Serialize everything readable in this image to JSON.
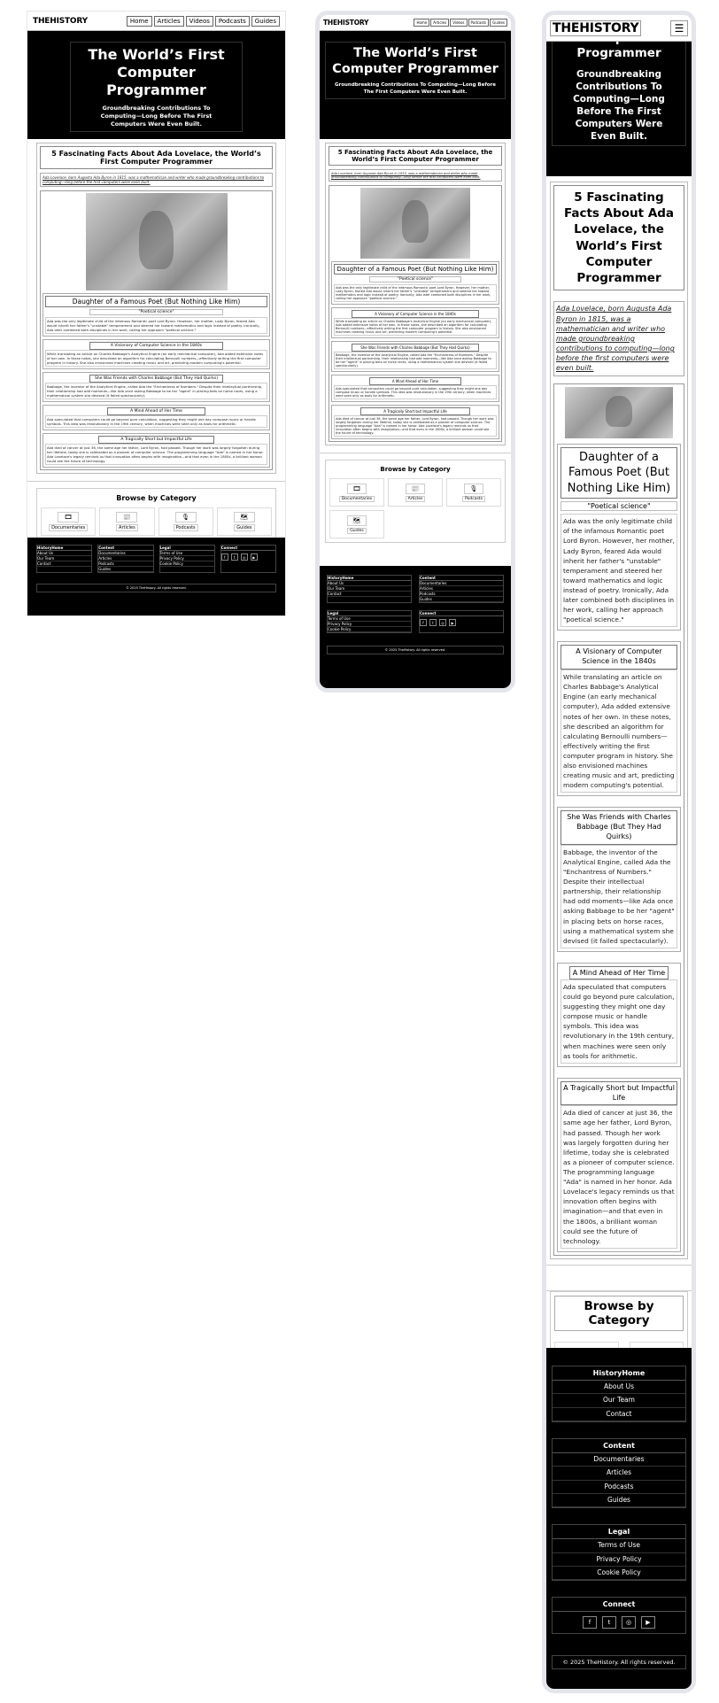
{
  "site": {
    "logo_prefix": "THE",
    "logo_suffix": "HISTORY",
    "nav": [
      "Home",
      "Articles",
      "Videos",
      "Podcasts",
      "Guides"
    ],
    "menu_icon": "hamburger-icon"
  },
  "hero": {
    "title": "The World’s First Computer Programmer",
    "subtitle": "Groundbreaking Contributions To Computing—Long Before The First Computers Were Even Built."
  },
  "article": {
    "title": "5 Fascinating Facts About Ada Lovelace, the World’s First Computer Programmer",
    "intro": "Ada Lovelace, born Augusta Ada Byron in 1815, was a mathematician and writer who made groundbreaking contributions to computing—long before the first computers were even built.",
    "image_alt": "Portrait of Ada Lovelace",
    "sections": [
      {
        "heading": "Daughter of a Famous Poet (But Nothing Like Him)",
        "subheading": "\"Poetical science\"",
        "text": "Ada was the only legitimate child of the infamous Romantic poet Lord Byron. However, her mother, Lady Byron, feared Ada would inherit her father's \"unstable\" temperament and steered her toward mathematics and logic instead of poetry. Ironically, Ada later combined both disciplines in her work, calling her approach \"poetical science.\""
      },
      {
        "heading": "A Visionary of Computer Science in the 1840s",
        "text": "While translating an article on Charles Babbage's Analytical Engine (an early mechanical computer), Ada added extensive notes of her own. In these notes, she described an algorithm for calculating Bernoulli numbers—effectively writing the first computer program in history. She also envisioned machines creating music and art, predicting modern computing's potential."
      },
      {
        "heading": "She Was Friends with Charles Babbage (But They Had Quirks)",
        "text": "Babbage, the inventor of the Analytical Engine, called Ada the \"Enchantress of Numbers.\" Despite their intellectual partnership, their relationship had odd moments—like Ada once asking Babbage to be her \"agent\" in placing bets on horse races, using a mathematical system she devised (it failed spectacularly)."
      },
      {
        "heading": "A Mind Ahead of Her Time",
        "text": "Ada speculated that computers could go beyond pure calculation, suggesting they might one day compose music or handle symbols. This idea was revolutionary in the 19th century, when machines were seen only as tools for arithmetic."
      },
      {
        "heading": "A Tragically Short but Impactful Life",
        "text": "Ada died of cancer at just 36, the same age her father, Lord Byron, had passed. Though her work was largely forgotten during her lifetime, today she is celebrated as a pioneer of computer science. The programming language \"Ada\" is named in her honor. Ada Lovelace's legacy reminds us that innovation often begins with imagination—and that even in the 1800s, a brilliant woman could see the future of technology."
      }
    ]
  },
  "browse": {
    "title": "Browse by Category",
    "categories": [
      {
        "label": "Documentaries",
        "icon": "film-icon"
      },
      {
        "label": "Articles",
        "icon": "newspaper-icon"
      },
      {
        "label": "Podcasts",
        "icon": "podcast-icon"
      },
      {
        "label": "Guides",
        "icon": "map-icon"
      }
    ]
  },
  "footer": {
    "columns": [
      {
        "title": "HistoryHome",
        "links": [
          "About Us",
          "Our Team",
          "Contact"
        ]
      },
      {
        "title": "Content",
        "links": [
          "Documentaries",
          "Articles",
          "Podcasts",
          "Guides"
        ]
      },
      {
        "title": "Legal",
        "links": [
          "Terms of Use",
          "Privacy Policy",
          "Cookie Policy"
        ]
      }
    ],
    "connect_title": "Connect",
    "social": [
      "facebook-icon",
      "twitter-icon",
      "instagram-icon",
      "youtube-icon"
    ],
    "copyright": "© 2025 TheHistory. All rights reserved."
  },
  "colors": {
    "background": "#ffffff",
    "hero": "#000000",
    "footer": "#000000",
    "frame_border": "#e3e5ea"
  }
}
